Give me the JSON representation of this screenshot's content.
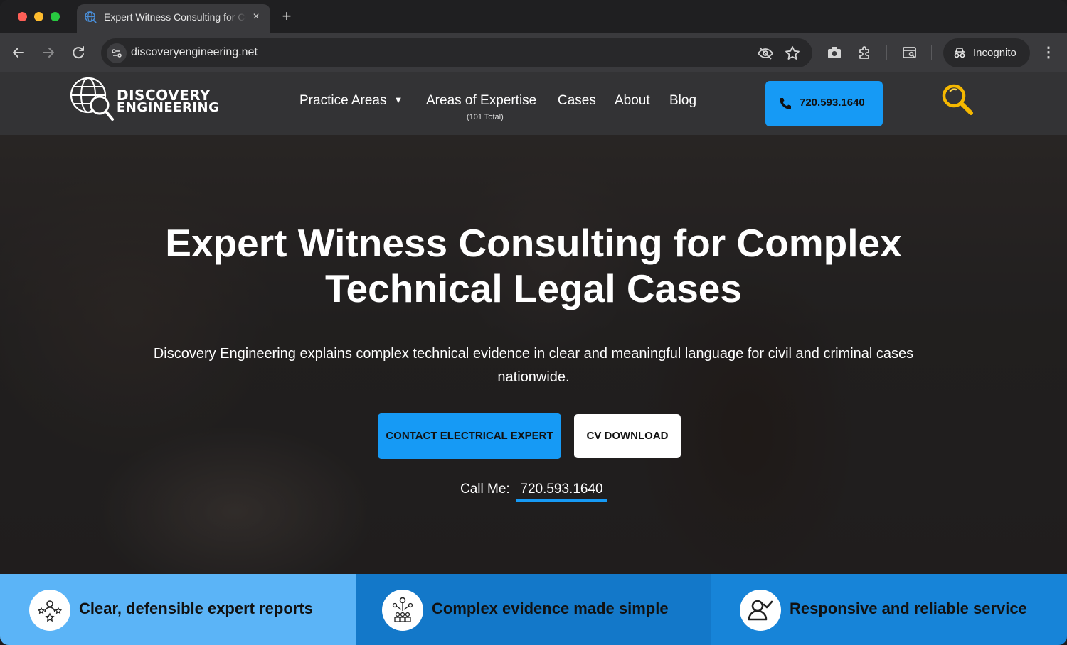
{
  "browser": {
    "tab_title": "Expert Witness Consulting for Complex Technical Legal Cases",
    "tab_close": "×",
    "new_tab": "+",
    "url": "discoveryengineering.net",
    "incognito_label": "Incognito",
    "menu_glyph": "⋮"
  },
  "header": {
    "logo_line1": "DISCOVERY",
    "logo_line2": "ENGINEERING",
    "nav": [
      {
        "label": "Practice Areas",
        "caret": "▼"
      },
      {
        "label": "Areas of Expertise",
        "sub": "(101 Total)"
      },
      {
        "label": "Cases"
      },
      {
        "label": "About"
      },
      {
        "label": "Blog"
      }
    ],
    "phone_label": "720.593.1640",
    "accent_color": "#169af5",
    "search_icon_color": "#f5b800"
  },
  "hero": {
    "title_line1": "Expert Witness Consulting for Complex",
    "title_line2": "Technical Legal Cases",
    "subtitle": "Discovery Engineering explains complex technical evidence in clear and meaningful language for civil and criminal cases nationwide.",
    "cta_primary": "CONTACT ELECTRICAL EXPERT",
    "cta_secondary": "CV DOWNLOAD",
    "call_label": "Call Me:",
    "call_number": "720.593.1640"
  },
  "features": [
    {
      "text": "Clear, defensible expert reports",
      "icon": "stars-team-icon",
      "color": "#5bb4f7"
    },
    {
      "text": "Complex evidence made simple",
      "icon": "network-people-icon",
      "color": "#1378c9"
    },
    {
      "text": "Responsive and reliable service",
      "icon": "user-check-icon",
      "color": "#1784d8"
    }
  ]
}
